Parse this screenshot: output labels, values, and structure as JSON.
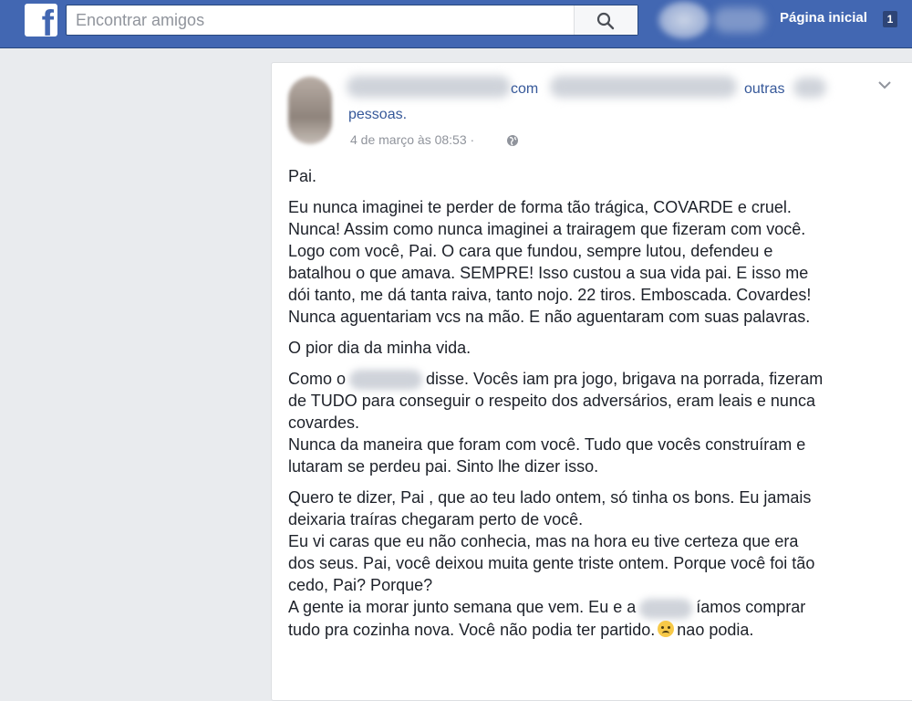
{
  "topbar": {
    "logo_letter": "f",
    "search_placeholder": "Encontrar amigos",
    "home_label": "Página inicial",
    "home_badge": "1"
  },
  "post": {
    "header_connector": "com",
    "header_others": "outras",
    "header_people": "pessoas.",
    "timestamp": "4 de março às 08:53 ·",
    "paragraphs": [
      {
        "lines": [
          "Pai."
        ]
      },
      {
        "lines": [
          "Eu nunca imaginei te perder de forma tão trágica, COVARDE e cruel.",
          "Nunca! Assim como nunca imaginei a trairagem que fizeram com você.",
          "Logo com você, Pai. O cara que fundou, sempre lutou, defendeu e",
          "batalhou o que amava. SEMPRE! Isso custou a sua vida pai. E isso me",
          "dói tanto, me dá tanta raiva, tanto nojo. 22 tiros. Emboscada. Covardes!",
          "Nunca aguentariam vcs na mão. E não aguentaram com suas palavras."
        ]
      },
      {
        "lines": [
          "O pior dia da minha vida."
        ]
      }
    ],
    "p4": {
      "before_blur": "Como o",
      "after_blur": "disse. Vocês iam pra jogo, brigava na porrada, fizeram",
      "lines": [
        "de TUDO para conseguir o respeito dos adversários, eram leais e nunca",
        "covardes.",
        "Nunca da maneira que foram com você. Tudo que vocês construíram e",
        "lutaram se perdeu pai. Sinto lhe dizer isso."
      ]
    },
    "p5": {
      "lines": [
        "Quero te dizer, Pai , que ao teu lado ontem, só tinha os bons. Eu jamais",
        "deixaria traíras chegaram perto de você.",
        "Eu vi caras que eu não conhecia, mas na hora eu tive certeza que era",
        "dos seus. Pai, você deixou muita gente triste ontem. Porque você foi tão",
        "cedo, Pai? Porque?"
      ],
      "line6_before": "A gente ia morar junto semana que vem. Eu e a",
      "line6_after": "íamos comprar",
      "line7_before": "tudo pra cozinha nova. Você não podia ter partido.",
      "line7_after": "nao podia."
    },
    "icons": {
      "globe": "globe-icon",
      "chevron": "chevron-down-icon",
      "emoji": "crying-face-emoji"
    }
  }
}
